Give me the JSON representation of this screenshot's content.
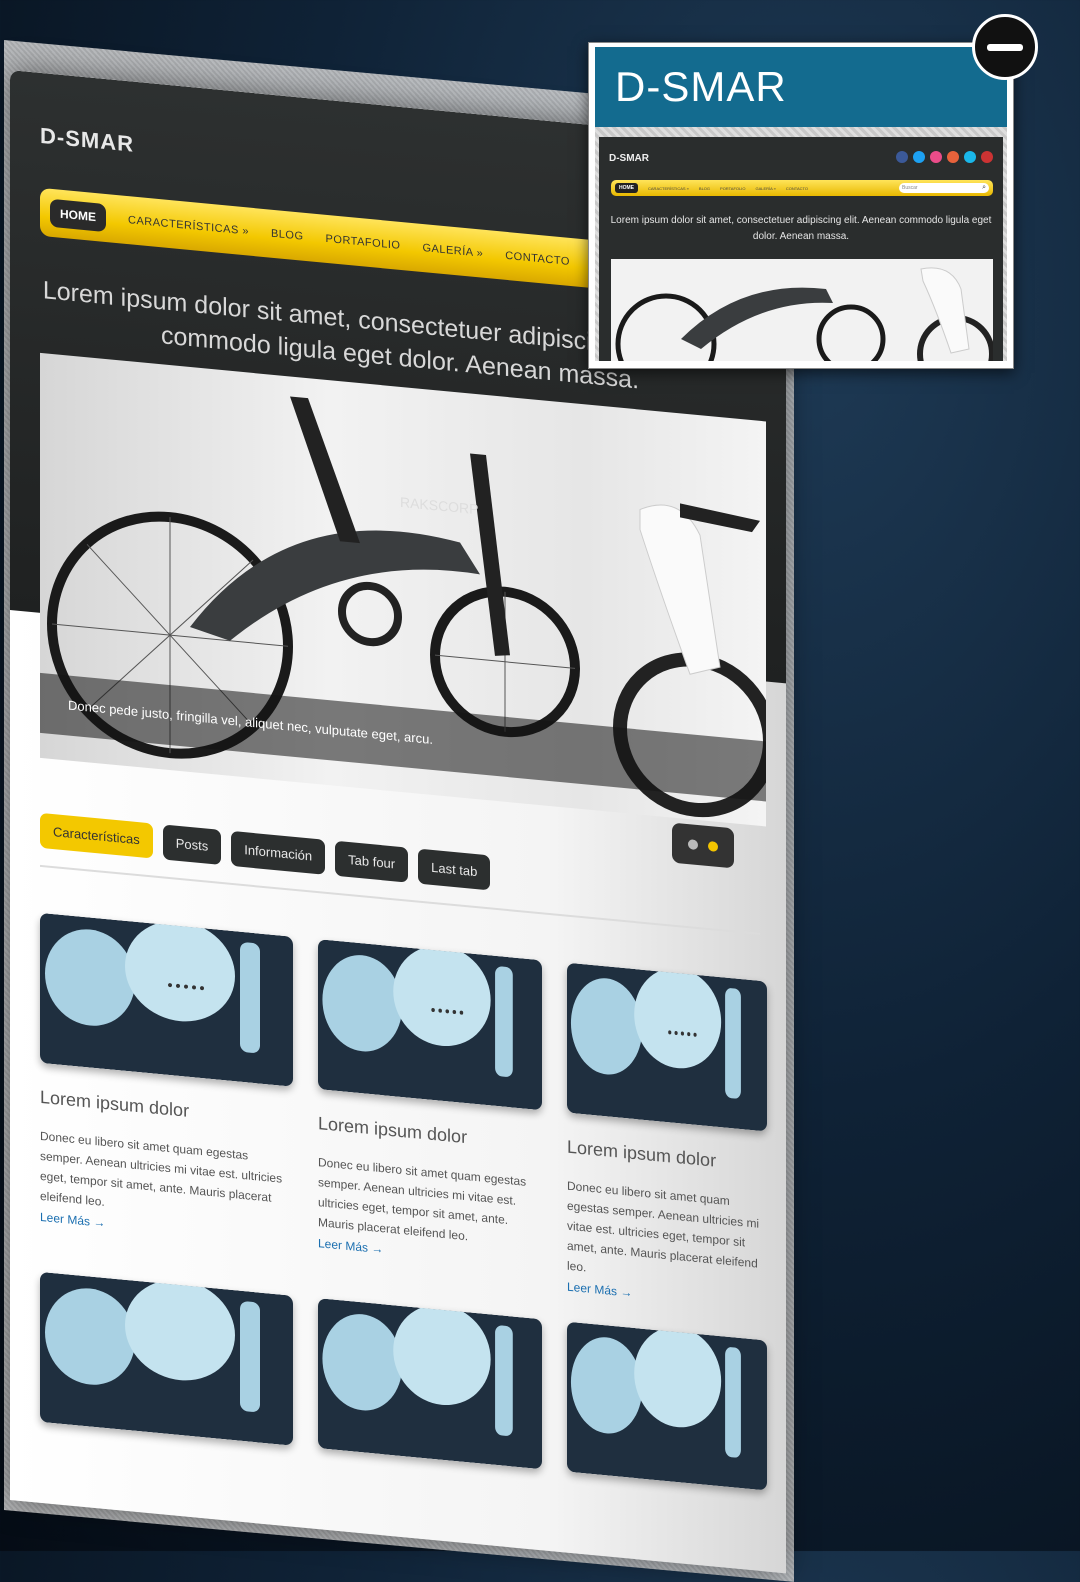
{
  "site": {
    "logo": "D-SMAR",
    "nav": {
      "home": "HOME",
      "items": [
        "CARACTERÍSTICAS »",
        "BLOG",
        "PORTAFOLIO",
        "GALERÍA »",
        "CONTACTO"
      ]
    },
    "tagline": "Lorem ipsum dolor sit amet, consectetuer adipiscing elit. Aenean commodo ligula eget dolor. Aenean massa.",
    "hero": {
      "caption": "Donec pede justo, fringilla vel, aliquet nec, vulputate eget, arcu.",
      "brand": "RAKSCORP",
      "slides": 2,
      "active_slide": 2
    },
    "tabs": [
      {
        "label": "Características",
        "active": true
      },
      {
        "label": "Posts",
        "active": false
      },
      {
        "label": "Información",
        "active": false
      },
      {
        "label": "Tab four",
        "active": false
      },
      {
        "label": "Last tab",
        "active": false
      }
    ],
    "cards": [
      {
        "title": "Lorem ipsum dolor",
        "text": "Donec eu libero sit amet quam egestas semper. Aenean ultricies mi vitae est. ultricies eget, tempor sit amet, ante. Mauris placerat eleifend leo.",
        "link": "Leer Más →"
      },
      {
        "title": "Lorem ipsum dolor",
        "text": "Donec eu libero sit amet quam egestas semper. Aenean ultricies mi vitae est. ultricies eget, tempor sit amet, ante. Mauris placerat eleifend leo.",
        "link": "Leer Más →"
      },
      {
        "title": "Lorem ipsum dolor",
        "text": "Donec eu libero sit amet quam egestas semper. Aenean ultricies mi vitae est. ultricies eget, tempor sit amet, ante. Mauris placerat eleifend leo.",
        "link": "Leer Más →"
      }
    ]
  },
  "preview": {
    "title": "D-SMAR",
    "mini_logo": "D-SMAR",
    "mini_tagline": "Lorem ipsum dolor sit amet, consectetuer adipiscing elit. Aenean commodo ligula eget dolor. Aenean massa.",
    "mini_nav_home": "HOME",
    "mini_nav_items": [
      "CARACTERÍSTICAS »",
      "BLOG",
      "PORTAFOLIO",
      "GALERÍA »",
      "CONTACTO"
    ],
    "mini_search": "Buscar",
    "social_icons": [
      "facebook-icon",
      "twitter-icon",
      "dribbble-icon",
      "googleplus-icon",
      "vimeo-icon",
      "youtube-icon"
    ]
  },
  "colors": {
    "accent_yellow": "#f3c800",
    "preview_bar": "#136b8f",
    "dark_bg": "#2a2d2d",
    "link_blue": "#1b6fb0"
  }
}
